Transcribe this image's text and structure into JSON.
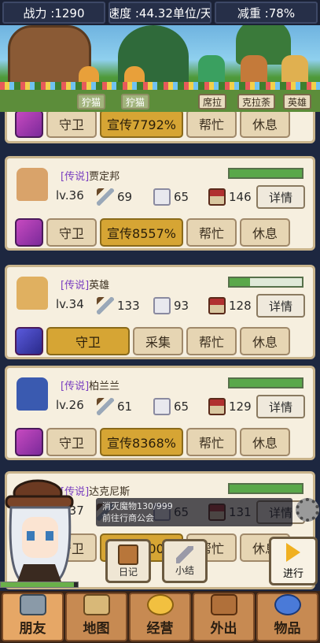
{
  "stats": {
    "power": "战力 :1290",
    "speed": "速度 :44.32单位/天",
    "weight_reduction": "减重 :78%"
  },
  "scene": {
    "tags": [
      "狞猫",
      "狞猫",
      "席拉",
      "克拉荼",
      "英雄"
    ]
  },
  "partial_card": {
    "actions": [
      "守卫",
      "宣传7792%",
      "帮忙",
      "休息"
    ]
  },
  "heroes": [
    {
      "rank": "[传说]",
      "name": "贾定邦",
      "level": "lv.36",
      "attack": "69",
      "intel": "65",
      "home": "146",
      "hp": 1.0,
      "details": "详情",
      "actions": [
        "守卫",
        "宣传8557%",
        "帮忙",
        "休息"
      ]
    },
    {
      "rank": "[传说]",
      "name": "英雄",
      "level": "lv.34",
      "attack": "133",
      "intel": "93",
      "home": "128",
      "hp": 0.28,
      "details": "详情",
      "actions": [
        "守卫",
        "采集",
        "帮忙",
        "休息"
      ]
    },
    {
      "rank": "[传说]",
      "name": "柏兰兰",
      "level": "lv.26",
      "attack": "61",
      "intel": "65",
      "home": "129",
      "hp": 1.0,
      "details": "详情",
      "actions": [
        "守卫",
        "宣传8368%",
        "帮忙",
        "休息"
      ]
    },
    {
      "rank": "[传说]",
      "name": "达克尼斯",
      "level": "lv.37",
      "attack": "",
      "intel": "65",
      "home": "131",
      "hp": 1.0,
      "details": "详情",
      "actions": [
        "守卫",
        "宣传8000%",
        "帮忙",
        "休息"
      ]
    }
  ],
  "quest": {
    "line1": "消灭魔物130/999",
    "line2": "前往行商公会"
  },
  "tools": {
    "diary": "日记",
    "summary": "小结",
    "proceed": "进行"
  },
  "nav": [
    "朋友",
    "地图",
    "经营",
    "外出",
    "物品"
  ],
  "progress": 0.95
}
